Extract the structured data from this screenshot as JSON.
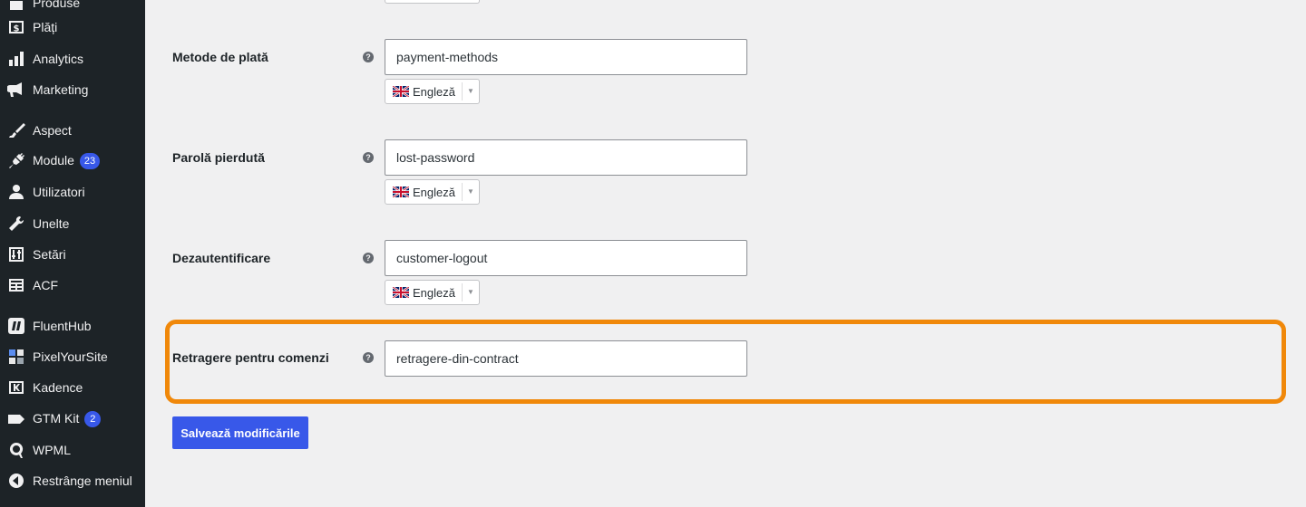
{
  "sidebar": {
    "items": [
      {
        "label": "Produse",
        "icon": "archive-icon"
      },
      {
        "label": "Plăți",
        "icon": "dollar-icon"
      },
      {
        "label": "Analytics",
        "icon": "bar-chart-icon"
      },
      {
        "label": "Marketing",
        "icon": "megaphone-icon"
      },
      {
        "label": "Aspect",
        "icon": "paintbrush-icon"
      },
      {
        "label": "Module",
        "icon": "plugin-icon",
        "badge": "23"
      },
      {
        "label": "Utilizatori",
        "icon": "user-icon"
      },
      {
        "label": "Unelte",
        "icon": "wrench-icon"
      },
      {
        "label": "Setări",
        "icon": "sliders-icon"
      },
      {
        "label": "ACF",
        "icon": "table-icon"
      },
      {
        "label": "FluentHub",
        "icon": "fluenthub-icon"
      },
      {
        "label": "PixelYourSite",
        "icon": "pixelyoursite-icon"
      },
      {
        "label": "Kadence",
        "icon": "kadence-icon"
      },
      {
        "label": "GTM Kit",
        "icon": "tag-icon",
        "badge": "2"
      },
      {
        "label": "WPML",
        "icon": "wpml-icon"
      },
      {
        "label": "Restrânge meniul",
        "icon": "collapse-arrow-icon"
      }
    ]
  },
  "form": {
    "fields": [
      {
        "label": "Metode de plată",
        "value": "payment-methods",
        "language": "Engleză"
      },
      {
        "label": "Parolă pierdută",
        "value": "lost-password",
        "language": "Engleză"
      },
      {
        "label": "Dezautentificare",
        "value": "customer-logout",
        "language": "Engleză"
      },
      {
        "label": "Retragere pentru comenzi",
        "value": "retragere-din-contract"
      }
    ],
    "help_glyph": "?",
    "dropdown_arrow": "▼",
    "save_label": "Salvează modificările"
  },
  "colors": {
    "sidebar_bg": "#1d2327",
    "page_bg": "#f0f0f1",
    "accent": "#3858e9",
    "highlight": "#f0880a"
  }
}
